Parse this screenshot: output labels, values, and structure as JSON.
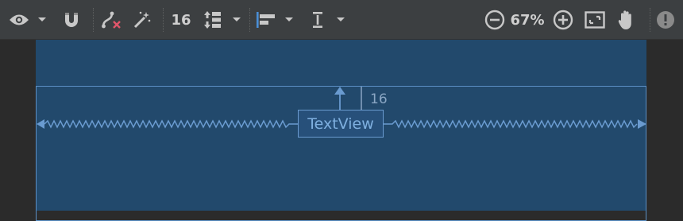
{
  "toolbar": {
    "default_margin": "16",
    "zoom_level": "67%"
  },
  "editor": {
    "widget_label": "TextView",
    "top_margin": "16"
  },
  "colors": {
    "toolbar_bg": "#3c3f41",
    "canvas_bg": "#2b2b2b",
    "device_bg": "#22496c",
    "constraint_blue": "#6a9bd0",
    "clear_constraints_red": "#e0556a"
  },
  "icons": [
    "eye-icon",
    "magnet-icon",
    "clear-constraints-icon",
    "magic-wand-icon",
    "pack-icon",
    "align-icon",
    "guidelines-icon",
    "zoom-out-icon",
    "zoom-in-icon",
    "zoom-to-fit-icon",
    "pan-hand-icon",
    "warnings-icon"
  ]
}
